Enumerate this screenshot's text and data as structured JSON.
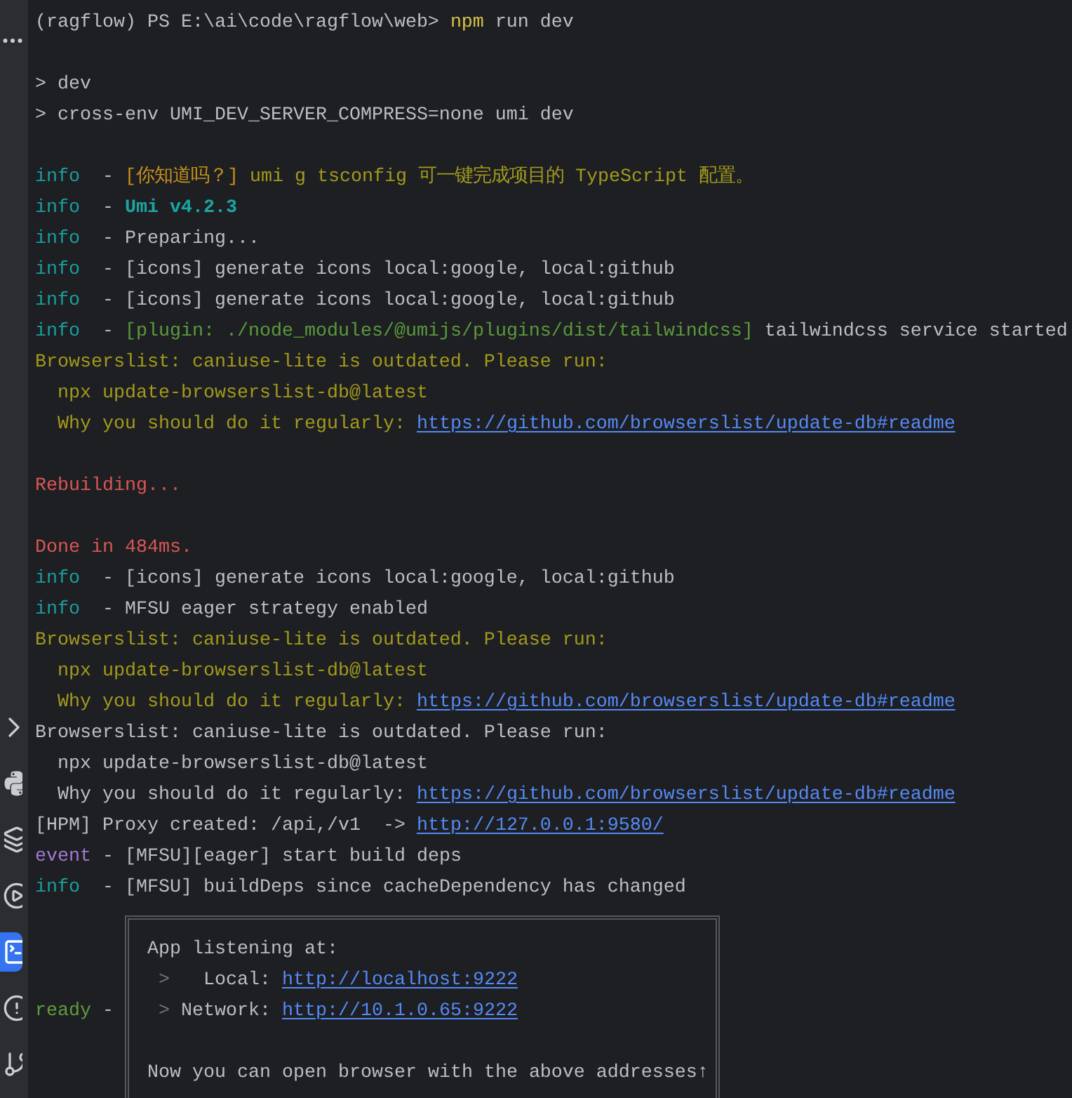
{
  "sidebar": {
    "tools": [
      {
        "selected": false
      },
      {
        "selected": false
      },
      {
        "selected": false
      },
      {
        "selected": false
      },
      {
        "selected": true
      },
      {
        "selected": false
      },
      {
        "selected": false
      }
    ]
  },
  "terminal": {
    "lines": [
      {
        "kind": "text",
        "segments": [
          {
            "text": "(ragflow) PS E:\\ai\\code\\ragflow\\web> ",
            "kind": "plain"
          },
          {
            "text": "npm",
            "kind": "command"
          },
          {
            "text": " run dev",
            "kind": "plain"
          }
        ]
      },
      {
        "kind": "blank"
      },
      {
        "kind": "text",
        "segments": [
          {
            "text": "> dev",
            "kind": "plain"
          }
        ]
      },
      {
        "kind": "text",
        "segments": [
          {
            "text": "> cross-env UMI_DEV_SERVER_COMPRESS=none umi dev",
            "kind": "plain"
          }
        ]
      },
      {
        "kind": "blank"
      },
      {
        "kind": "text",
        "segments": [
          {
            "text": "info",
            "kind": "info"
          },
          {
            "text": "  - ",
            "kind": "plain"
          },
          {
            "text": "[你知道吗？]",
            "kind": "tag"
          },
          {
            "text": " umi g tsconfig 可一键完成项目的 TypeScript 配置。",
            "kind": "warn"
          }
        ]
      },
      {
        "kind": "text",
        "segments": [
          {
            "text": "info",
            "kind": "info"
          },
          {
            "text": "  - ",
            "kind": "plain"
          },
          {
            "text": "Umi v4.2.3",
            "kind": "version"
          }
        ]
      },
      {
        "kind": "text",
        "segments": [
          {
            "text": "info",
            "kind": "info"
          },
          {
            "text": "  - Preparing...",
            "kind": "plain"
          }
        ]
      },
      {
        "kind": "text",
        "segments": [
          {
            "text": "info",
            "kind": "info"
          },
          {
            "text": "  - [icons] generate icons local:google, local:github",
            "kind": "plain"
          }
        ]
      },
      {
        "kind": "text",
        "segments": [
          {
            "text": "info",
            "kind": "info"
          },
          {
            "text": "  - [icons] generate icons local:google, local:github",
            "kind": "plain"
          }
        ]
      },
      {
        "kind": "text",
        "segments": [
          {
            "text": "info",
            "kind": "info"
          },
          {
            "text": "  - ",
            "kind": "plain"
          },
          {
            "text": "[plugin: ./node_modules/@umijs/plugins/dist/tailwindcss]",
            "kind": "plugin"
          },
          {
            "text": " tailwindcss service started",
            "kind": "plain"
          }
        ]
      },
      {
        "kind": "text",
        "segments": [
          {
            "text": "Browserslist: caniuse-lite is outdated. Please run:",
            "kind": "warn"
          }
        ]
      },
      {
        "kind": "text",
        "segments": [
          {
            "text": "  npx update-browserslist-db@latest",
            "kind": "warn"
          }
        ]
      },
      {
        "kind": "text",
        "segments": [
          {
            "text": "  Why you should do it regularly: ",
            "kind": "warn"
          },
          {
            "text": "https://github.com/browserslist/update-db#readme",
            "kind": "link"
          }
        ]
      },
      {
        "kind": "blank"
      },
      {
        "kind": "text",
        "segments": [
          {
            "text": "Rebuilding...",
            "kind": "error"
          }
        ]
      },
      {
        "kind": "blank"
      },
      {
        "kind": "text",
        "segments": [
          {
            "text": "Done in 484ms.",
            "kind": "error"
          }
        ]
      },
      {
        "kind": "text",
        "segments": [
          {
            "text": "info",
            "kind": "info"
          },
          {
            "text": "  - [icons] generate icons local:google, local:github",
            "kind": "plain"
          }
        ]
      },
      {
        "kind": "text",
        "segments": [
          {
            "text": "info",
            "kind": "info"
          },
          {
            "text": "  - MFSU eager strategy enabled",
            "kind": "plain"
          }
        ]
      },
      {
        "kind": "text",
        "segments": [
          {
            "text": "Browserslist: caniuse-lite is outdated. Please run:",
            "kind": "warn"
          }
        ]
      },
      {
        "kind": "text",
        "segments": [
          {
            "text": "  npx update-browserslist-db@latest",
            "kind": "warn"
          }
        ]
      },
      {
        "kind": "text",
        "segments": [
          {
            "text": "  Why you should do it regularly: ",
            "kind": "warn"
          },
          {
            "text": "https://github.com/browserslist/update-db#readme",
            "kind": "link"
          }
        ]
      },
      {
        "kind": "text",
        "segments": [
          {
            "text": "Browserslist: caniuse-lite is outdated. Please run:",
            "kind": "plain"
          }
        ]
      },
      {
        "kind": "text",
        "segments": [
          {
            "text": "  npx update-browserslist-db@latest",
            "kind": "plain"
          }
        ]
      },
      {
        "kind": "text",
        "segments": [
          {
            "text": "  Why you should do it regularly: ",
            "kind": "plain"
          },
          {
            "text": "https://github.com/browserslist/update-db#readme",
            "kind": "link"
          }
        ]
      },
      {
        "kind": "text",
        "segments": [
          {
            "text": "[HPM] Proxy created: /api,/v1  -> ",
            "kind": "plain"
          },
          {
            "text": "http://127.0.0.1:9580/",
            "kind": "link"
          }
        ]
      },
      {
        "kind": "text",
        "segments": [
          {
            "text": "event",
            "kind": "event"
          },
          {
            "text": " - [MFSU][eager] start build deps",
            "kind": "plain"
          }
        ]
      },
      {
        "kind": "text",
        "segments": [
          {
            "text": "info",
            "kind": "info"
          },
          {
            "text": "  - [MFSU] buildDeps since cacheDependency has changed",
            "kind": "plain"
          }
        ]
      }
    ],
    "box": {
      "rows": [
        {
          "kind": "text",
          "segments": [
            {
              "text": "App listening at:",
              "kind": "plain"
            }
          ]
        },
        {
          "kind": "text",
          "segments": [
            {
              "text": ">",
              "kind": "dim"
            },
            {
              "text": "   Local: ",
              "kind": "plain"
            },
            {
              "text": "http://localhost:9222",
              "kind": "link"
            }
          ]
        },
        {
          "kind": "text",
          "prefix": [
            {
              "text": "ready",
              "kind": "ready"
            },
            {
              "text": " -",
              "kind": "plain"
            }
          ],
          "segments": [
            {
              "text": ">",
              "kind": "dim"
            },
            {
              "text": " Network: ",
              "kind": "plain"
            },
            {
              "text": "http://10.1.0.65:9222",
              "kind": "link"
            }
          ]
        },
        {
          "kind": "blank"
        },
        {
          "kind": "text",
          "segments": [
            {
              "text": "Now you can open browser with the above addresses↑",
              "kind": "plain"
            }
          ]
        }
      ]
    }
  }
}
